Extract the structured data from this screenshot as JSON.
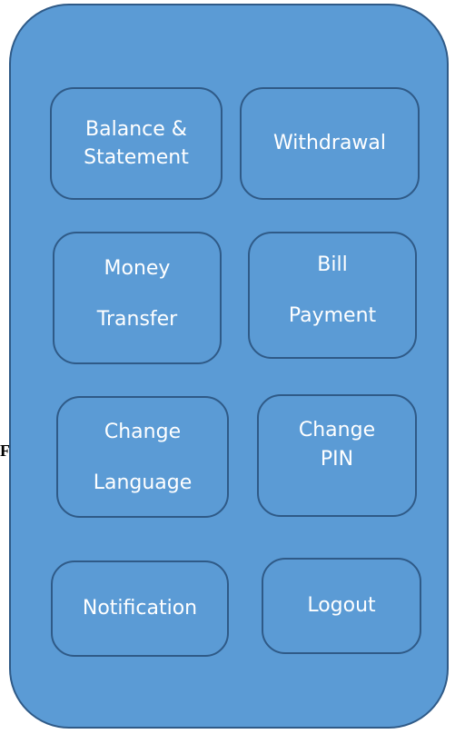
{
  "menu": {
    "balance_statement": {
      "line1": "Balance &",
      "line2": "Statement"
    },
    "withdrawal": {
      "line1": "Withdrawal"
    },
    "money_transfer": {
      "line1": "Money",
      "line2": "Transfer"
    },
    "bill_payment": {
      "line1": "Bill",
      "line2": "Payment"
    },
    "change_language": {
      "line1": "Change",
      "line2": "Language"
    },
    "change_pin": {
      "line1": "Change",
      "line2": "PIN"
    },
    "notification": {
      "line1": "Notification"
    },
    "logout": {
      "line1": "Logout"
    }
  },
  "stray_text": "F",
  "colors": {
    "panel_fill": "#5b9bd5",
    "panel_border": "#2f5a87",
    "tile_text": "#ffffff",
    "page_background": "#ffffff"
  }
}
